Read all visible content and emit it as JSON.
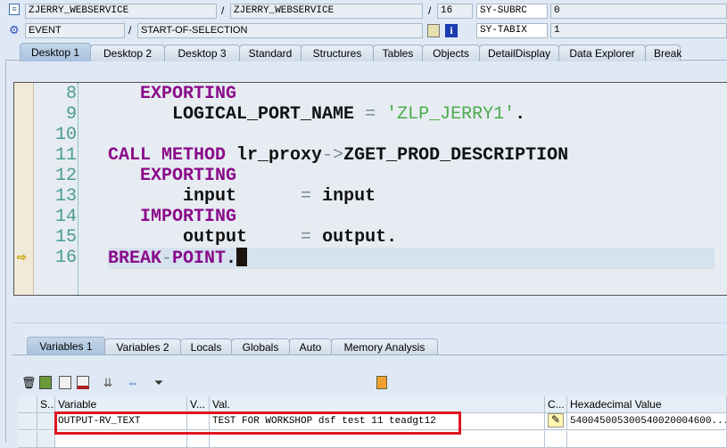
{
  "header": {
    "program": "ZJERRY_WEBSERVICE",
    "include": "ZJERRY_WEBSERVICE",
    "line": "16",
    "subrc_label": "SY-SUBRC",
    "subrc_value": "0",
    "event_type": "EVENT",
    "event_name": "START-OF-SELECTION",
    "tabix_label": "SY-TABIX",
    "tabix_value": "1",
    "slash": "/"
  },
  "desktop_tabs": [
    "Desktop 1",
    "Desktop 2",
    "Desktop 3",
    "Standard",
    "Structures",
    "Tables",
    "Objects",
    "DetailDisplay",
    "Data Explorer",
    "Break"
  ],
  "code": {
    "lines": [
      {
        "n": "8",
        "t": [
          [
            "   ",
            ""
          ],
          [
            "EXPORTING",
            "kw"
          ]
        ]
      },
      {
        "n": "9",
        "t": [
          [
            "      ",
            ""
          ],
          [
            "LOGICAL_PORT_NAME ",
            "id"
          ],
          [
            "=",
            "op"
          ],
          [
            " ",
            ""
          ],
          [
            "'ZLP_JERRY1'",
            "str"
          ],
          [
            ".",
            "id"
          ]
        ]
      },
      {
        "n": "10",
        "t": []
      },
      {
        "n": "11",
        "t": [
          [
            "CALL METHOD ",
            "kw"
          ],
          [
            "lr_proxy",
            "id"
          ],
          [
            "->",
            "op"
          ],
          [
            "ZGET_PROD_DESCRIPTION",
            "id"
          ]
        ]
      },
      {
        "n": "12",
        "t": [
          [
            "   ",
            ""
          ],
          [
            "EXPORTING",
            "kw"
          ]
        ]
      },
      {
        "n": "13",
        "t": [
          [
            "       ",
            ""
          ],
          [
            "input      ",
            "id"
          ],
          [
            "=",
            "op"
          ],
          [
            " input",
            "id"
          ]
        ]
      },
      {
        "n": "14",
        "t": [
          [
            "   ",
            ""
          ],
          [
            "IMPORTING",
            "kw"
          ]
        ]
      },
      {
        "n": "15",
        "t": [
          [
            "       ",
            ""
          ],
          [
            "output     ",
            "id"
          ],
          [
            "=",
            "op"
          ],
          [
            " output.",
            "id"
          ]
        ]
      },
      {
        "n": "16",
        "t": [
          [
            "BREAK",
            "kw"
          ],
          [
            "-",
            "op"
          ],
          [
            "POINT",
            "kw"
          ],
          [
            ".",
            "id"
          ]
        ],
        "current": true
      }
    ]
  },
  "var_tabs": [
    "Variables 1",
    "Variables 2",
    "Locals",
    "Globals",
    "Auto",
    "Memory Analysis"
  ],
  "grid": {
    "headers": [
      "S...",
      "Variable",
      "V...",
      "Val.",
      "C...",
      "Hexadecimal Value"
    ],
    "row": {
      "variable": "OUTPUT-RV_TEXT",
      "value": "TEST FOR WORKSHOP dsf test 11 teadgt12",
      "hex": "540045005300540020004600..."
    }
  },
  "colors": {
    "highlight_box": "#e0141e",
    "keyword": "#8a0a8a",
    "string": "#4caa4c"
  }
}
